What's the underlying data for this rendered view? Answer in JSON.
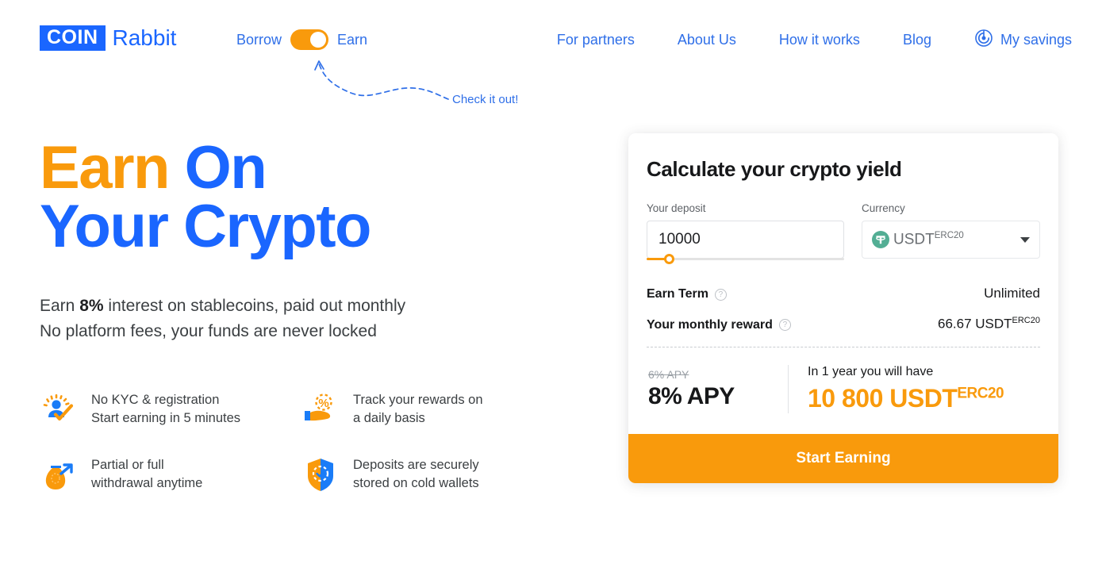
{
  "brand": {
    "badge": "COIN",
    "word": "Rabbit"
  },
  "mode_toggle": {
    "left_label": "Borrow",
    "right_label": "Earn",
    "state": "Earn",
    "color": "#f99a0c"
  },
  "annotation": {
    "text": "Check it out!",
    "color": "#2f6fe8"
  },
  "nav": {
    "items": [
      {
        "label": "For partners"
      },
      {
        "label": "About Us"
      },
      {
        "label": "How it works"
      },
      {
        "label": "Blog"
      },
      {
        "label": "My savings",
        "icon": "savings-spiral-icon"
      }
    ]
  },
  "hero": {
    "title_part1": "Earn",
    "title_part2": " On",
    "title_line2": "Your Crypto",
    "accent_color": "#f99a0c",
    "title_color": "#1a66ff",
    "sub_line1_pre": "Earn ",
    "sub_line1_bold": "8%",
    "sub_line1_post": " interest on stablecoins, paid out monthly",
    "sub_line2": "No platform fees, your funds are never locked"
  },
  "features": [
    {
      "icon": "user-check-icon",
      "line1": "No KYC & registration",
      "line2": "Start earning in 5 minutes"
    },
    {
      "icon": "hand-percent-icon",
      "line1": "Track your rewards on",
      "line2": "a daily basis"
    },
    {
      "icon": "money-bag-arrow-icon",
      "line1": "Partial or full",
      "line2": "withdrawal anytime"
    },
    {
      "icon": "shield-check-icon",
      "line1": "Deposits are securely",
      "line2": "stored on cold wallets"
    }
  ],
  "calculator": {
    "title": "Calculate your crypto yield",
    "deposit_label": "Your deposit",
    "deposit_value": "10000",
    "deposit_placeholder": "Enter amount",
    "currency_label": "Currency",
    "currency_value": "USDT",
    "currency_network": "ERC20",
    "currency_icon": "tether-icon",
    "rows": [
      {
        "label": "Earn Term",
        "help": "?",
        "value": "Unlimited",
        "sup": ""
      },
      {
        "label": "Your monthly reward",
        "help": "?",
        "value": "66.67 USDT",
        "sup": "ERC20"
      }
    ],
    "old_apy": "6% APY",
    "new_apy": "8% APY",
    "year_caption": "In 1 year you will have",
    "year_amount": "10 800 USDT",
    "year_amount_sup": "ERC20",
    "cta_label": "Start Earning",
    "cta_color": "#f99a0c"
  }
}
